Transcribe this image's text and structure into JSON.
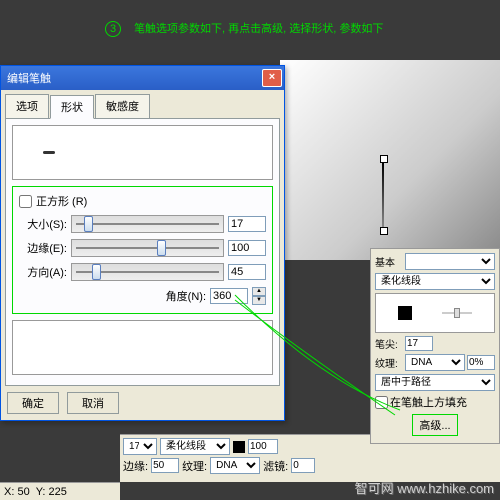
{
  "annotation": {
    "num": "3",
    "text": "笔触选项参数如下, 再点击高级, 选择形状, 参数如下"
  },
  "dialog": {
    "title": "编辑笔触",
    "tabs": {
      "options": "选项",
      "shape": "形状",
      "sensitivity": "敏感度"
    },
    "square_label": "正方形 (R)",
    "size": {
      "label": "大小(S):",
      "value": "17"
    },
    "edge": {
      "label": "边缘(E):",
      "value": "100"
    },
    "dir": {
      "label": "方向(A):",
      "value": "45"
    },
    "angle": {
      "label": "角度(N):",
      "value": "360"
    },
    "buttons": {
      "ok": "确定",
      "cancel": "取消"
    }
  },
  "panel": {
    "base_label": "基本",
    "stroke_type": "柔化线段",
    "tip_label": "笔尖:",
    "tip_val": "17",
    "texture_label": "纹理:",
    "texture_val": "DNA",
    "texture_pct": "0%",
    "center_label": "居中于路径",
    "fill_label": "在笔触上方填充",
    "advanced": "高级..."
  },
  "bottom": {
    "size_val": "17",
    "stroke": "柔化线段",
    "pct": "100",
    "edge_label": "边缘:",
    "edge_val": "50",
    "texture_label": "纹理:",
    "texture_val": "DNA",
    "filter_label": "滤镜:",
    "filter_pct": "0"
  },
  "status": {
    "x": "X: 50",
    "y": "Y: 225"
  },
  "watermark": "智可网 www.hzhike.com"
}
